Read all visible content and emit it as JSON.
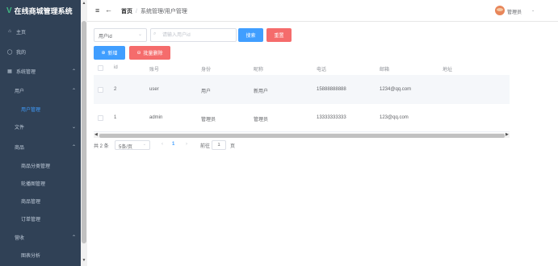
{
  "app": {
    "title": "在线商城管理系统",
    "logo_letter": "V"
  },
  "sidebar": {
    "items": [
      {
        "label": "主页",
        "icon": "home-icon",
        "glyph": "⌂"
      },
      {
        "label": "我的",
        "icon": "user-icon",
        "glyph": "◯"
      },
      {
        "label": "系统管理",
        "icon": "grid-icon",
        "glyph": "▦"
      },
      {
        "label": "用户",
        "icon": "",
        "glyph": ""
      },
      {
        "label": "用户管理",
        "icon": "",
        "glyph": ""
      },
      {
        "label": "文件",
        "icon": "",
        "glyph": ""
      },
      {
        "label": "商品",
        "icon": "",
        "glyph": ""
      },
      {
        "label": "商品分类管理",
        "icon": "",
        "glyph": ""
      },
      {
        "label": "轮播图管理",
        "icon": "",
        "glyph": ""
      },
      {
        "label": "商品管理",
        "icon": "",
        "glyph": ""
      },
      {
        "label": "订单管理",
        "icon": "",
        "glyph": ""
      },
      {
        "label": "营收",
        "icon": "",
        "glyph": ""
      },
      {
        "label": "图表分析",
        "icon": "",
        "glyph": ""
      }
    ],
    "colors": {
      "bg": "#304156",
      "text": "#bfcbd9",
      "active": "#409eff"
    }
  },
  "header": {
    "breadcrumb_home": "首页",
    "breadcrumb_separator": "/",
    "breadcrumb_current": "系统管理/用户管理",
    "username": "管理员"
  },
  "toolbar": {
    "select_value": "用户id",
    "search_placeholder": "请输入用户id",
    "search_label": "搜索",
    "reset_label": "重置",
    "add_label": "新增",
    "batch_delete_label": "批量删除"
  },
  "table": {
    "columns": [
      "id",
      "账号",
      "身份",
      "昵称",
      "电话",
      "邮箱",
      "地址"
    ],
    "rows": [
      [
        "2",
        "user",
        "用户",
        "新用户",
        "15888888888",
        "1234@qq.com",
        ""
      ],
      [
        "1",
        "admin",
        "管理员",
        "管理员",
        "13333333333",
        "123@qq.com",
        ""
      ]
    ]
  },
  "pagination": {
    "total_text": "共 2 条",
    "page_size": "5条/页",
    "current_page": "1",
    "goto_label": "前往",
    "goto_value": "1",
    "page_unit": "页"
  },
  "colors": {
    "primary": "#409eff",
    "danger": "#f56c6c",
    "logo": "#41b883"
  }
}
